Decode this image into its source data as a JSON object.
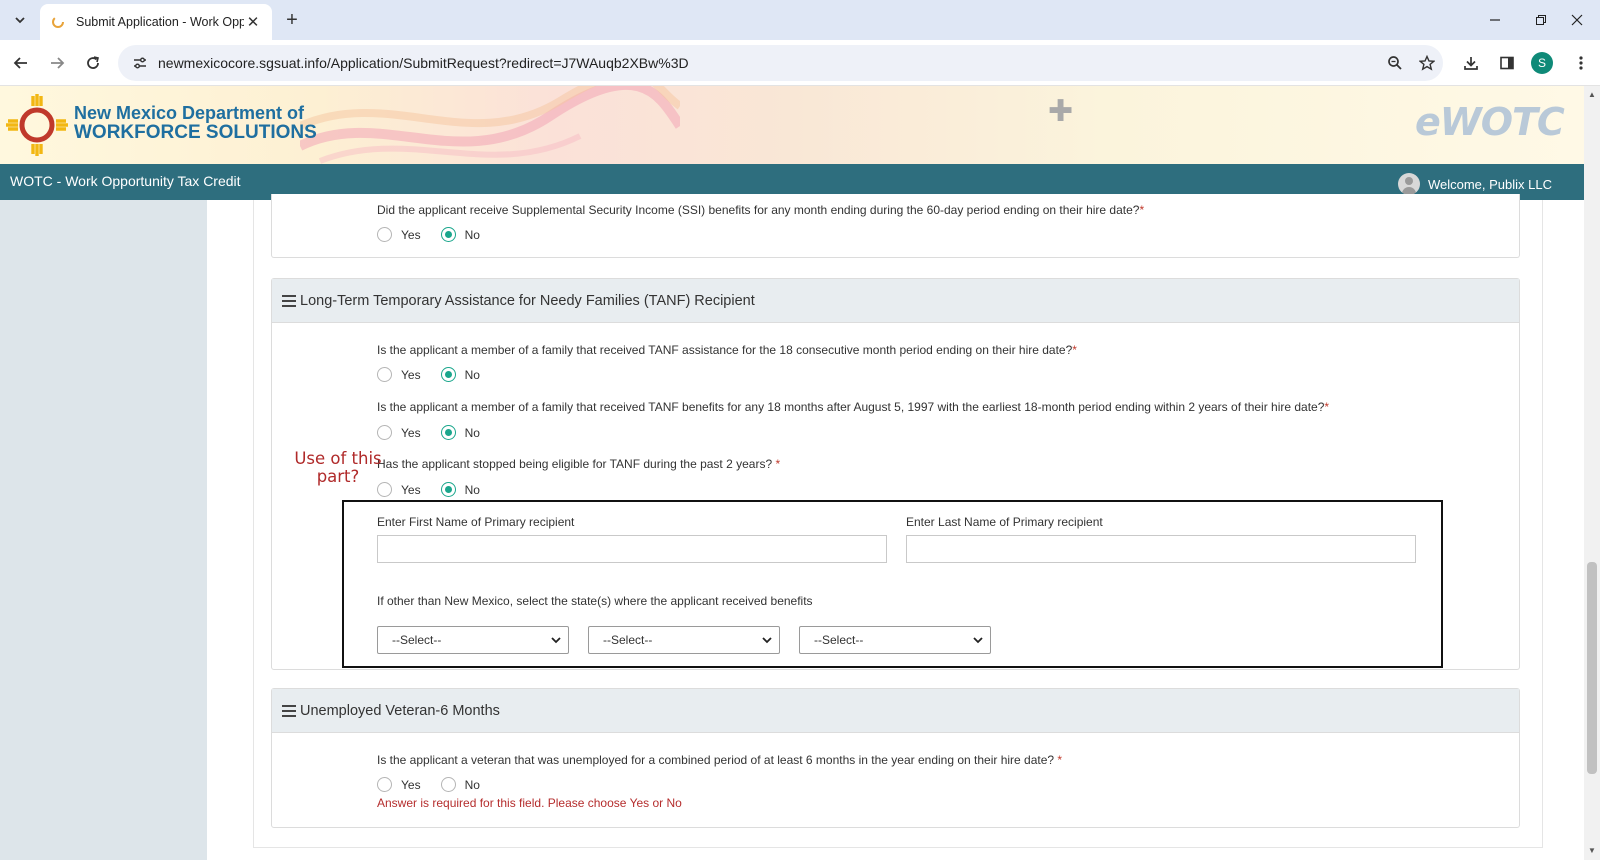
{
  "browser": {
    "tab_title": "Submit Application - Work Opp",
    "url": "newmexicocore.sgsuat.info/Application/SubmitRequest?redirect=J7WAuqb2XBw%3D",
    "profile_initial": "S"
  },
  "header": {
    "org_line1": "New Mexico Department of",
    "org_line2": "WORKFORCE SOLUTIONS",
    "brand": "eWOTC",
    "app_title": "WOTC - Work Opportunity Tax Credit",
    "welcome": "Welcome, Publix LLC"
  },
  "ssi": {
    "question": "Did the applicant receive Supplemental Security Income (SSI) benefits for any month ending during the 60-day period ending on their hire date?",
    "required_mark": "*",
    "yes": "Yes",
    "no": "No",
    "selected": "No"
  },
  "tanf": {
    "title": "Long-Term Temporary Assistance for Needy Families (TANF) Recipient",
    "questions": [
      {
        "text": "Is the applicant a member of a family that received TANF assistance for the 18 consecutive month period ending on their hire date?",
        "required_mark": "*",
        "selected": "No"
      },
      {
        "text": "Is the applicant a member of a family that received TANF benefits for any 18 months after August 5, 1997 with the earliest 18-month period ending within 2 years of their hire date?",
        "required_mark": "*",
        "selected": "No"
      },
      {
        "text": "Has the applicant stopped being eligible for TANF during the past 2 years?",
        "required_mark": " *",
        "selected": "No"
      }
    ],
    "yes": "Yes",
    "no": "No",
    "first_name_label": "Enter First Name of Primary recipient",
    "first_name_value": "",
    "last_name_label": "Enter Last Name of Primary recipient",
    "last_name_value": "",
    "states_label": "If other than New Mexico, select the state(s) where the applicant received benefits",
    "state_selects": [
      "--Select--",
      "--Select--",
      "--Select--"
    ]
  },
  "annotation": {
    "line1": "Use of this",
    "line2": "part?"
  },
  "veteran": {
    "title": "Unemployed Veteran-6 Months",
    "question": "Is the applicant a veteran that was unemployed for a combined period of at least 6 months in the year ending on their hire date?",
    "required_mark": " *",
    "yes": "Yes",
    "no": "No",
    "selected": null,
    "error": "Answer is required for this field. Please choose Yes or No"
  },
  "colors": {
    "appbar": "#2e6e7e",
    "radio_selected": "#1aa68c",
    "error": "#b52d2d",
    "annotation": "#b02a2a"
  }
}
